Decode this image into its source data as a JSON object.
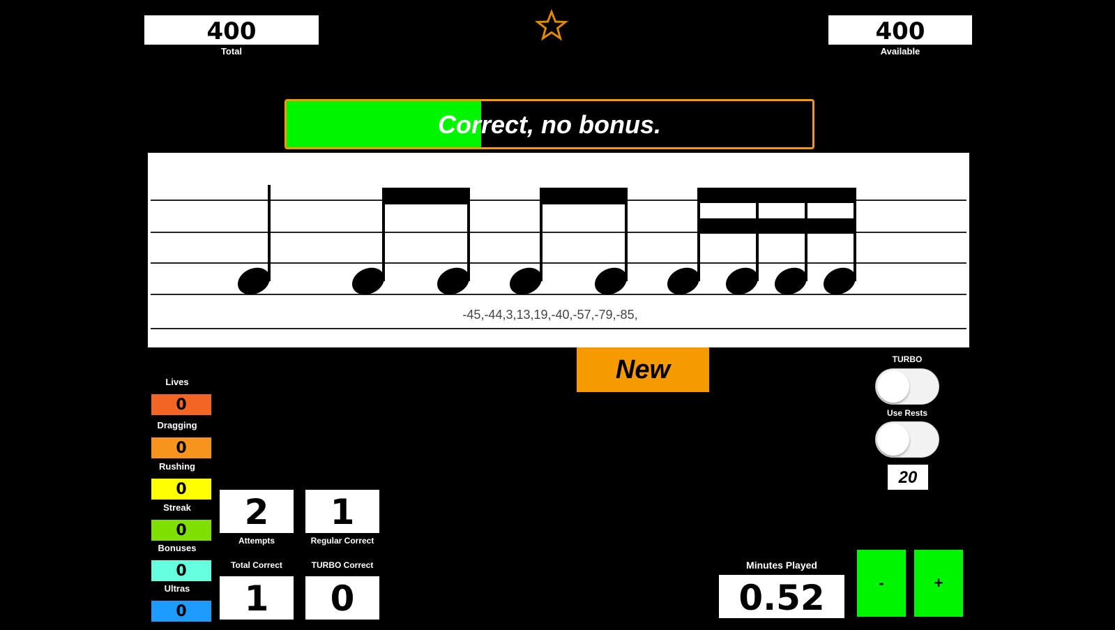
{
  "header": {
    "total_value": "400",
    "total_label": "Total",
    "available_value": "400",
    "available_label": "Available",
    "star_icon": "star-outline-icon",
    "star_color": "#e08a00"
  },
  "feedback": {
    "message": "Correct, no bonus.",
    "progress_fraction": 0.37,
    "fill_color": "#00f500",
    "border_color": "#f59a00"
  },
  "staff": {
    "timing_values": "-45,-44,3,13,19,-40,-57,-79,-85,"
  },
  "controls": {
    "new_label": "New",
    "turbo_label": "TURBO",
    "use_rests_label": "Use Rests",
    "count_value": "20"
  },
  "stats": [
    {
      "label": "Lives",
      "value": "0",
      "color": "#f26522"
    },
    {
      "label": "Dragging",
      "value": "0",
      "color": "#f7941d"
    },
    {
      "label": "Rushing",
      "value": "0",
      "color": "#ffff00"
    },
    {
      "label": "Streak",
      "value": "0",
      "color": "#7fe000"
    },
    {
      "label": "Bonuses",
      "value": "0",
      "color": "#66ffdd"
    },
    {
      "label": "Ultras",
      "value": "0",
      "color": "#1e9bff"
    }
  ],
  "counts": {
    "attempts_value": "2",
    "attempts_label": "Attempts",
    "regular_correct_value": "1",
    "regular_correct_label": "Regular Correct",
    "total_correct_label": "Total Correct",
    "total_correct_value": "1",
    "turbo_correct_label": "TURBO Correct",
    "turbo_correct_value": "0"
  },
  "minutes": {
    "label": "Minutes Played",
    "value": "0.52",
    "minus_label": "-",
    "plus_label": "+"
  }
}
